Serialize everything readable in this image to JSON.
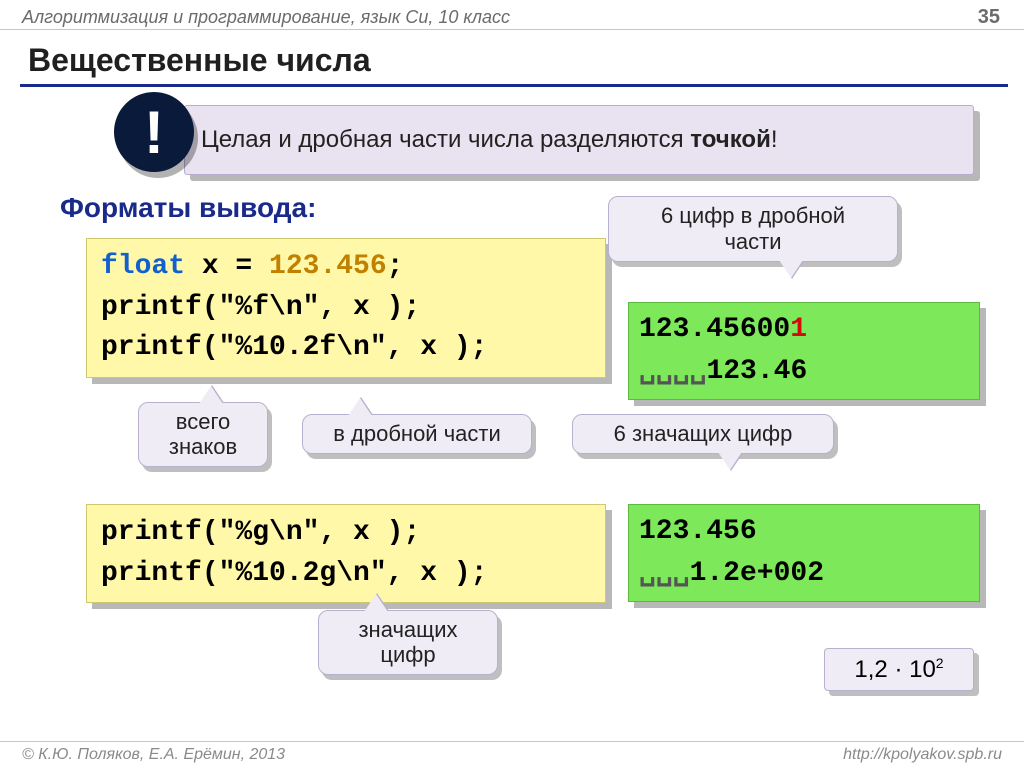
{
  "header": {
    "course": "Алгоритмизация и программирование, язык Си, 10 класс",
    "page": "35"
  },
  "title": "Вещественные числа",
  "alert": {
    "text": "Целая и дробная части числа разделяются ",
    "strong": "точкой",
    "excl": "!"
  },
  "subhead": "Форматы вывода:",
  "code1": {
    "l1_kw": "float",
    "l1_rest": " x = ",
    "l1_num": "123.456",
    "l1_tail": ";",
    "l2": "printf(\"%f\\n\", x );",
    "l3": "printf(\"%10.2f\\n\", x );"
  },
  "out1": {
    "l1_pre": "123.45600",
    "l1_red": "1",
    "l2_spaces": "␣␣␣␣",
    "l2_val": "123.46"
  },
  "code2": {
    "l1": "printf(\"%g\\n\", x );",
    "l2": "printf(\"%10.2g\\n\", x );"
  },
  "out2": {
    "l1": "123.456",
    "l2_spaces": "␣␣␣",
    "l2_val": "1.2e+002"
  },
  "tips": {
    "t1a": "6 цифр в дробной",
    "t1b": "части",
    "t2a": "всего",
    "t2b": "знаков",
    "t3": "в дробной части",
    "t4": "6 значащих цифр",
    "t5a": "значащих",
    "t5b": "цифр"
  },
  "math": {
    "base": "1,2 · 10",
    "exp": "2"
  },
  "footer": {
    "left": "© К.Ю. Поляков, Е.А. Ерёмин, 2013",
    "right": "http://kpolyakov.spb.ru"
  }
}
